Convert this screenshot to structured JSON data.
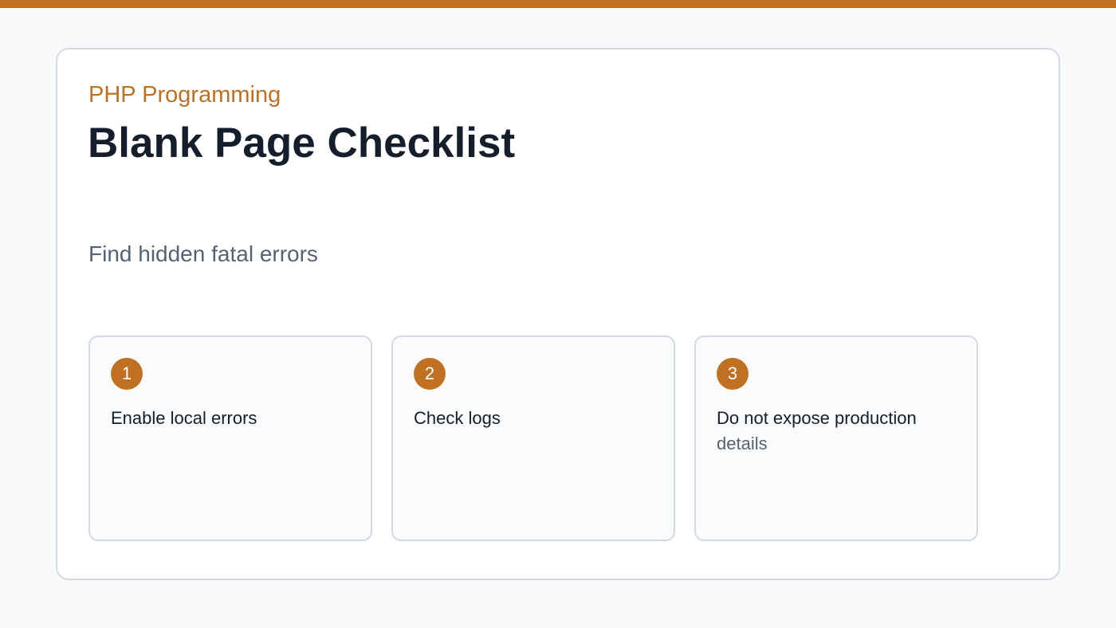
{
  "header": {
    "eyebrow": "PHP Programming",
    "title": "Blank Page Checklist",
    "subtitle": "Find hidden fatal errors"
  },
  "steps": [
    {
      "number": "1",
      "text": "Enable local errors",
      "text_line2": ""
    },
    {
      "number": "2",
      "text": "Check logs",
      "text_line2": ""
    },
    {
      "number": "3",
      "text": "Do not expose production",
      "text_line2": "details"
    }
  ],
  "colors": {
    "accent": "#bf7020",
    "title": "#141e2c",
    "muted": "#566272",
    "border": "#d3d8e2",
    "background": "#f8f9fb"
  }
}
